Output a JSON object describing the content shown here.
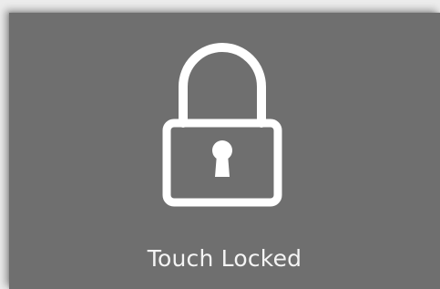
{
  "lock_screen": {
    "icon": "padlock-icon",
    "status_text": "Touch Locked",
    "colors": {
      "panel": "#6f6f6f",
      "foreground": "#ffffff"
    }
  }
}
